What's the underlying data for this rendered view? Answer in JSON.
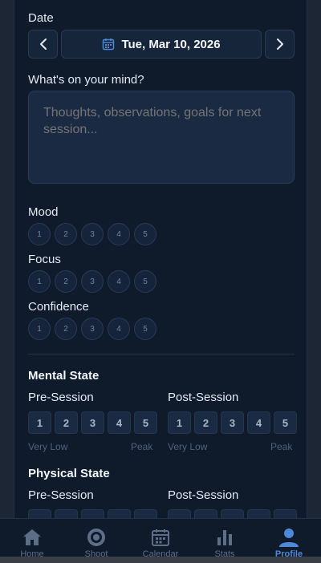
{
  "date": {
    "label": "Date",
    "value": "Tue, Mar 10, 2026"
  },
  "notes": {
    "label": "What's on your mind?",
    "placeholder": "Thoughts, observations, goals for next session..."
  },
  "ratings": [
    {
      "label": "Mood",
      "options": [
        "1",
        "2",
        "3",
        "4",
        "5"
      ]
    },
    {
      "label": "Focus",
      "options": [
        "1",
        "2",
        "3",
        "4",
        "5"
      ]
    },
    {
      "label": "Confidence",
      "options": [
        "1",
        "2",
        "3",
        "4",
        "5"
      ]
    }
  ],
  "mental_state": {
    "title": "Mental State",
    "pre": {
      "label": "Pre-Session",
      "options": [
        "1",
        "2",
        "3",
        "4",
        "5"
      ],
      "low": "Very Low",
      "high": "Peak"
    },
    "post": {
      "label": "Post-Session",
      "options": [
        "1",
        "2",
        "3",
        "4",
        "5"
      ],
      "low": "Very Low",
      "high": "Peak"
    }
  },
  "physical_state": {
    "title": "Physical State",
    "pre": {
      "label": "Pre-Session"
    },
    "post": {
      "label": "Post-Session"
    }
  },
  "tabs": [
    {
      "label": "Home",
      "icon": "home-icon"
    },
    {
      "label": "Shoot",
      "icon": "target-icon"
    },
    {
      "label": "Calendar",
      "icon": "calendar-icon"
    },
    {
      "label": "Stats",
      "icon": "bar-chart-icon"
    },
    {
      "label": "Profile",
      "icon": "user-icon",
      "active": true
    }
  ],
  "colors": {
    "accent": "#4e89d9",
    "background": "#0f1a2b"
  }
}
